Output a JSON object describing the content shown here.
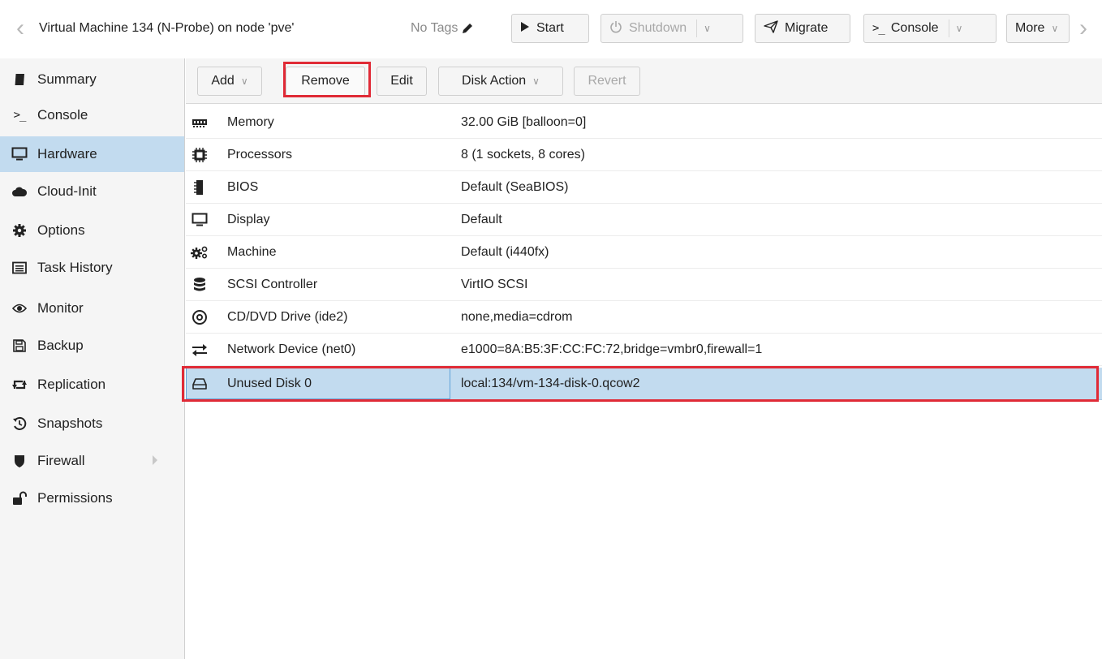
{
  "header": {
    "title": "Virtual Machine 134 (N-Probe) on node 'pve'",
    "tags": "No Tags",
    "buttons": {
      "start": "Start",
      "shutdown": "Shutdown",
      "migrate": "Migrate",
      "console": "Console",
      "more": "More"
    },
    "prompt_glyph": ">_"
  },
  "sidebar": {
    "items": [
      {
        "label": "Summary",
        "icon": "book-icon"
      },
      {
        "label": "Console",
        "icon": "terminal-prompt-icon"
      },
      {
        "label": "Hardware",
        "icon": "desktop-icon",
        "active": true
      },
      {
        "label": "Cloud-Init",
        "icon": "cloud-icon"
      },
      {
        "label": "Options",
        "icon": "gear-icon"
      },
      {
        "label": "Task History",
        "icon": "list-alt-icon"
      },
      {
        "label": "Monitor",
        "icon": "eye-icon"
      },
      {
        "label": "Backup",
        "icon": "floppy-icon"
      },
      {
        "label": "Replication",
        "icon": "retweet-icon"
      },
      {
        "label": "Snapshots",
        "icon": "history-icon"
      },
      {
        "label": "Firewall",
        "icon": "shield-icon"
      },
      {
        "label": "Permissions",
        "icon": "unlock-icon"
      }
    ]
  },
  "toolbar": {
    "add": "Add",
    "remove": "Remove",
    "edit": "Edit",
    "disk_action": "Disk Action",
    "revert": "Revert"
  },
  "hardware": {
    "rows": [
      {
        "key": "Memory",
        "value": "32.00 GiB [balloon=0]",
        "icon": "memory-icon"
      },
      {
        "key": "Processors",
        "value": "8 (1 sockets, 8 cores)",
        "icon": "cpu-icon"
      },
      {
        "key": "BIOS",
        "value": "Default (SeaBIOS)",
        "icon": "microchip-icon"
      },
      {
        "key": "Display",
        "value": "Default",
        "icon": "desktop-icon"
      },
      {
        "key": "Machine",
        "value": "Default (i440fx)",
        "icon": "cogs-icon"
      },
      {
        "key": "SCSI Controller",
        "value": "VirtIO SCSI",
        "icon": "database-icon"
      },
      {
        "key": "CD/DVD Drive (ide2)",
        "value": "none,media=cdrom",
        "icon": "cdrom-icon"
      },
      {
        "key": "Network Device (net0)",
        "value": "e1000=8A:B5:3F:CC:FC:72,bridge=vmbr0,firewall=1",
        "icon": "exchange-icon"
      },
      {
        "key": "Unused Disk 0",
        "value": "local:134/vm-134-disk-0.qcow2",
        "icon": "hdd-icon",
        "selected": true
      }
    ]
  },
  "colors": {
    "selection": "#c2dbef",
    "highlight": "#e02a36",
    "sidebar_bg": "#f5f5f5"
  }
}
